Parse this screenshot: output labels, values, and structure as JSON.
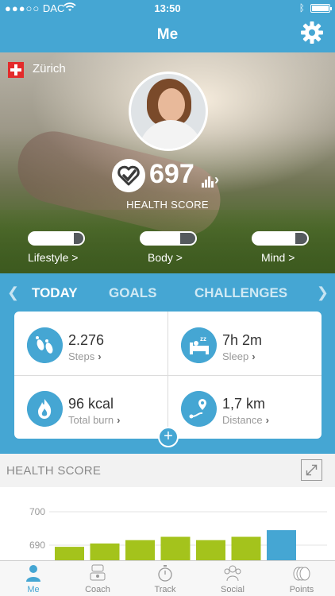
{
  "status_bar": {
    "carrier": "DAC",
    "signal_dots": "●●●○○",
    "time": "13:50"
  },
  "header": {
    "title": "Me"
  },
  "profile": {
    "location": "Zürich",
    "health_score": "697",
    "health_score_label": "HEALTH SCORE",
    "categories": [
      {
        "label": "Lifestyle >",
        "level": 0.82
      },
      {
        "label": "Body >",
        "level": 0.72
      },
      {
        "label": "Mind >",
        "level": 0.78
      }
    ]
  },
  "tabs": [
    "TODAY",
    "GOALS",
    "CHALLENGES"
  ],
  "active_tab": "TODAY",
  "metrics": [
    {
      "value": "2.276",
      "label": "Steps",
      "icon": "footsteps-icon"
    },
    {
      "value": "7h 2m",
      "label": "Sleep",
      "icon": "sleep-bed-icon"
    },
    {
      "value": "96 kcal",
      "label": "Total burn",
      "icon": "flame-icon"
    },
    {
      "value": "1,7 km",
      "label": "Distance",
      "icon": "route-icon"
    }
  ],
  "health_chart": {
    "title": "HEALTH SCORE",
    "chart_data": {
      "type": "bar",
      "title": "",
      "yticks": [
        "700",
        "690"
      ],
      "values": [
        689.5,
        690.5,
        691.5,
        692.5,
        691.5,
        692.5,
        694.5
      ],
      "colors": [
        "#a4c31c",
        "#a4c31c",
        "#a4c31c",
        "#a4c31c",
        "#a4c31c",
        "#a4c31c",
        "#45a6d3"
      ]
    }
  },
  "tabbar": [
    {
      "label": "Me",
      "icon": "person-icon",
      "active": true
    },
    {
      "label": "Coach",
      "icon": "coach-icon",
      "active": false
    },
    {
      "label": "Track",
      "icon": "stopwatch-icon",
      "active": false
    },
    {
      "label": "Social",
      "icon": "group-icon",
      "active": false
    },
    {
      "label": "Points",
      "icon": "coins-icon",
      "active": false
    }
  ],
  "colors": {
    "brand_blue": "#45a6d3",
    "bar_green": "#a4c31c"
  }
}
